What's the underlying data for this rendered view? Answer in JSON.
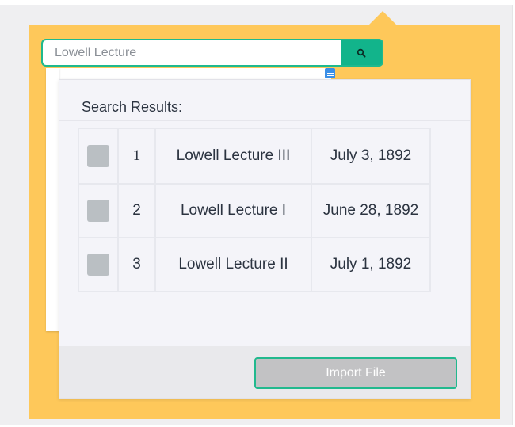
{
  "search": {
    "value": "Lowell Lecture",
    "icon": "search-icon"
  },
  "results": {
    "title": "Search Results:",
    "rows": [
      {
        "number": "1",
        "title": "Lowell Lecture III",
        "date": "July 3, 1892",
        "checked": false
      },
      {
        "number": "2",
        "title": "Lowell Lecture I",
        "date": "June 28, 1892",
        "checked": false
      },
      {
        "number": "3",
        "title": "Lowell Lecture II",
        "date": "July 1, 1892",
        "checked": false
      }
    ]
  },
  "footer": {
    "import_label": "Import File"
  },
  "colors": {
    "panel": "#fec85a",
    "accent": "#1fb98e",
    "checkbox": "#babfc3",
    "button_disabled": "#c2c2c4"
  }
}
